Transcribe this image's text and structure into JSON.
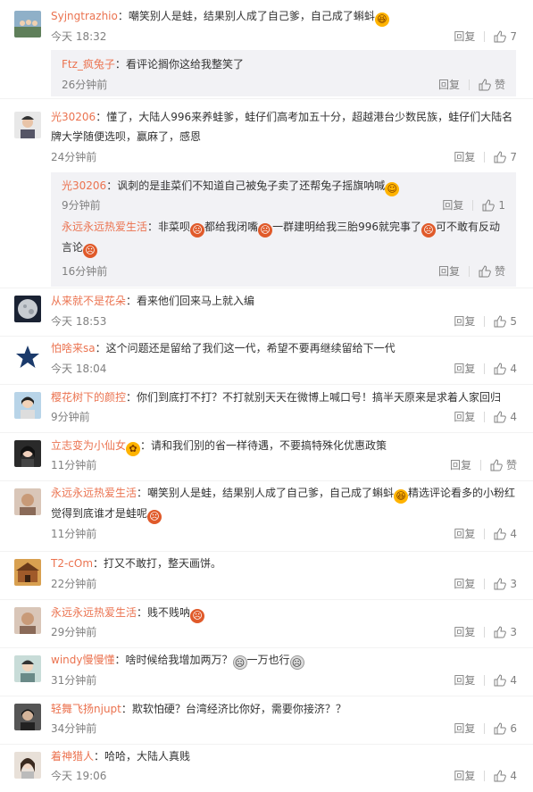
{
  "ui": {
    "reply_label": "回复",
    "accent": "#eb7350"
  },
  "comments": [
    {
      "user": "Syjngtrazhio",
      "text": "嘲笑别人是蛙，结果别人成了自己爹，自己成了蝌蚪",
      "time": "今天 18:32",
      "likes": "7",
      "avatar": "avatar-group"
    },
    {
      "user": "光30206",
      "text": "懂了，大陆人996来养蛙爹，蛙仔们高考加五十分，超越港台少数民族，蛙仔们大陆名牌大学随便选呗，赢麻了，感恩",
      "time": "24分钟前",
      "likes": "7",
      "avatar": "avatar-person"
    },
    {
      "user": "从来就不是花朵",
      "text": "看来他们回来马上就入编",
      "time": "今天 18:53",
      "likes": "5",
      "avatar": "avatar-moon"
    },
    {
      "user": "怕啥来sa",
      "text": "这个问题还是留给了我们这一代，希望不要再继续留给下一代",
      "time": "今天 18:04",
      "likes": "4",
      "avatar": "avatar-star"
    },
    {
      "user": "樱花树下的颜控",
      "text": "你们到底打不打？不打就别天天在微博上喊口号！搞半天原来是求着人家回归",
      "time": "9分钟前",
      "likes": "4",
      "avatar": "avatar-person"
    },
    {
      "user": "立志变为小仙女",
      "text": "请和我们别的省一样待遇，不要搞特殊化优惠政策",
      "time": "11分钟前",
      "likes": "赞",
      "avatar": "avatar-person"
    },
    {
      "user": "永远永远热爱生活",
      "text1": "嘲笑别人是蛙，结果别人成了自己爹，自己成了蝌蚪",
      "text2": "精选评论看多的小粉红觉得到底谁才是蛙呢",
      "time": "11分钟前",
      "likes": "4",
      "avatar": "avatar-person"
    },
    {
      "user": "T2-cOm",
      "text": "打又不敢打，整天画饼。",
      "time": "22分钟前",
      "likes": "3",
      "avatar": "avatar-building"
    },
    {
      "user": "永远永远热爱生活",
      "text": "贱不贱呐",
      "time": "29分钟前",
      "likes": "3",
      "avatar": "avatar-person"
    },
    {
      "user": "windy慢慢懂",
      "text1": "啥时候给我增加两万？",
      "text2": "一万也行",
      "time": "31分钟前",
      "likes": "4",
      "avatar": "avatar-person"
    },
    {
      "user": "轻舞飞扬njupt",
      "text": "欺软怕硬？台湾经济比你好，需要你接济？？",
      "time": "34分钟前",
      "likes": "6",
      "avatar": "avatar-person"
    },
    {
      "user": "着神猎人",
      "text": "哈哈，大陆人真贱",
      "time": "今天 19:06",
      "likes": "4",
      "avatar": "avatar-person"
    }
  ],
  "subs": [
    {
      "user": "Ftz_疯兔子",
      "text": "看评论搁你这给我整笑了",
      "time": "26分钟前",
      "likes": "赞"
    },
    {
      "user": "光30206",
      "text": "讽刺的是韭菜们不知道自己被兔子卖了还帮兔子摇旗呐喊",
      "time": "9分钟前",
      "likes": "1"
    },
    {
      "user": "永远永远热爱生活",
      "text1": "非菜呗",
      "text2": "都给我闭嘴",
      "text3": "一群建明给我三胎996就完事了",
      "text4": "可不敢有反动言论",
      "time": "16分钟前",
      "likes": "赞"
    }
  ]
}
